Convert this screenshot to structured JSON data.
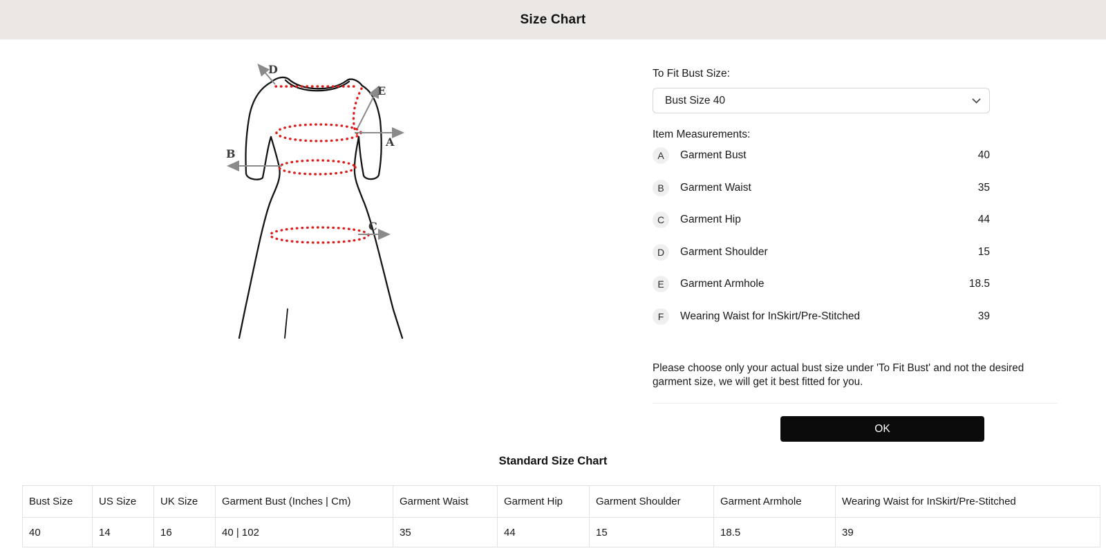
{
  "header": {
    "title": "Size Chart"
  },
  "fit": {
    "label": "To Fit Bust Size:",
    "selected": "Bust Size 40"
  },
  "measurements": {
    "label": "Item Measurements:",
    "items": [
      {
        "key": "A",
        "label": "Garment Bust",
        "value": "40"
      },
      {
        "key": "B",
        "label": "Garment Waist",
        "value": "35"
      },
      {
        "key": "C",
        "label": "Garment Hip",
        "value": "44"
      },
      {
        "key": "D",
        "label": "Garment Shoulder",
        "value": "15"
      },
      {
        "key": "E",
        "label": "Garment Armhole",
        "value": "18.5"
      },
      {
        "key": "F",
        "label": "Wearing Waist for InSkirt/Pre-Stitched",
        "value": "39"
      }
    ]
  },
  "note": "Please choose only your actual bust size under 'To Fit Bust' and not the desired garment size, we will get it best fitted for you.",
  "ok_label": "OK",
  "diagram": {
    "labels": [
      "A",
      "B",
      "C",
      "D",
      "E"
    ]
  },
  "size_chart": {
    "title": "Standard Size Chart",
    "columns": [
      "Bust Size",
      "US Size",
      "UK Size",
      "Garment Bust (Inches | Cm)",
      "Garment Waist",
      "Garment Hip",
      "Garment Shoulder",
      "Garment Armhole",
      "Wearing Waist for InSkirt/Pre-Stitched"
    ],
    "rows": [
      [
        "40",
        "14",
        "16",
        "40 | 102",
        "35",
        "44",
        "15",
        "18.5",
        "39"
      ]
    ]
  },
  "colors": {
    "header_bg": "#ebe7e5",
    "measure_red": "#dd1c1c",
    "arrow_gray": "#8a8a8a",
    "ok_button_bg": "#0b0b0b"
  }
}
